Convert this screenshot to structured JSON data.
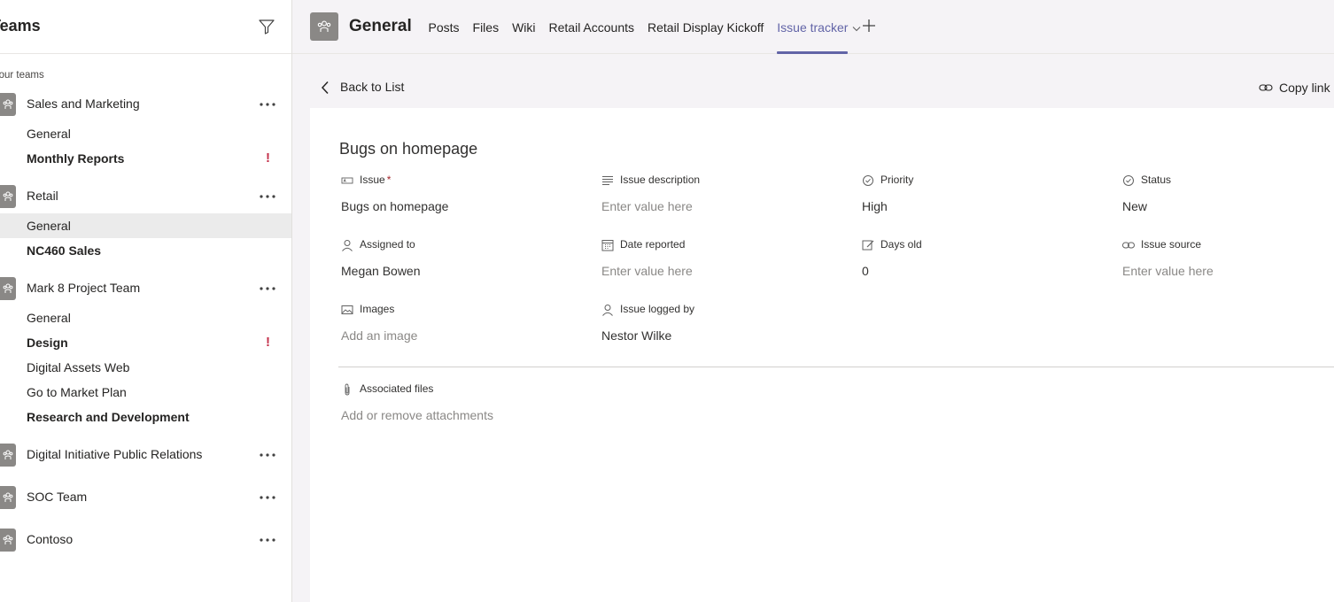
{
  "sidebar": {
    "title": "Teams",
    "section_label": "Your teams",
    "teams": [
      {
        "name": "Sales and Marketing",
        "channels": [
          {
            "name": "General",
            "bold": false,
            "alert": false
          },
          {
            "name": "Monthly Reports",
            "bold": true,
            "alert": true
          }
        ]
      },
      {
        "name": "Retail",
        "channels": [
          {
            "name": "General",
            "bold": false,
            "alert": false,
            "active": true
          },
          {
            "name": "NC460 Sales",
            "bold": true,
            "alert": false
          }
        ]
      },
      {
        "name": "Mark 8 Project Team",
        "channels": [
          {
            "name": "General",
            "bold": false,
            "alert": false
          },
          {
            "name": "Design",
            "bold": true,
            "alert": true
          },
          {
            "name": "Digital Assets Web",
            "bold": false,
            "alert": false
          },
          {
            "name": "Go to Market Plan",
            "bold": false,
            "alert": false
          },
          {
            "name": "Research and Development",
            "bold": true,
            "alert": false
          }
        ]
      },
      {
        "name": "Digital Initiative Public Relations",
        "channels": []
      },
      {
        "name": "SOC Team",
        "channels": []
      },
      {
        "name": "Contoso",
        "channels": []
      }
    ],
    "alert_glyph": "!"
  },
  "header": {
    "channel_title": "General",
    "tabs": [
      {
        "label": "Posts"
      },
      {
        "label": "Files"
      },
      {
        "label": "Wiki"
      },
      {
        "label": "Retail Accounts"
      },
      {
        "label": "Retail Display Kickoff"
      },
      {
        "label": "Issue tracker",
        "active": true
      }
    ],
    "accent_color": "#6264a7"
  },
  "main": {
    "back_label": "Back to List",
    "copy_label": "Copy link",
    "item_title": "Bugs on homepage",
    "fields": {
      "issue": {
        "label": "Issue",
        "required_mark": "*",
        "value": "Bugs on homepage",
        "icon": "text-field-icon"
      },
      "issue_description": {
        "label": "Issue description",
        "value": "Enter value here",
        "icon": "multiline-text-icon"
      },
      "priority": {
        "label": "Priority",
        "value": "High",
        "icon": "choice-icon"
      },
      "status": {
        "label": "Status",
        "value": "New",
        "icon": "choice-icon"
      },
      "assigned_to": {
        "label": "Assigned to",
        "value": "Megan Bowen",
        "icon": "person-icon"
      },
      "date_reported": {
        "label": "Date reported",
        "value": "Enter value here",
        "icon": "calendar-icon"
      },
      "days_old": {
        "label": "Days old",
        "value": "0",
        "icon": "calculated-icon"
      },
      "issue_source": {
        "label": "Issue source",
        "value": "Enter value here",
        "icon": "link-icon"
      },
      "images": {
        "label": "Images",
        "value": "Add an image",
        "icon": "image-icon"
      },
      "issue_logged_by": {
        "label": "Issue logged by",
        "value": "Nestor Wilke",
        "icon": "person-icon"
      },
      "associated_files": {
        "label": "Associated files",
        "value": "Add or remove attachments",
        "icon": "paperclip-icon"
      }
    }
  }
}
